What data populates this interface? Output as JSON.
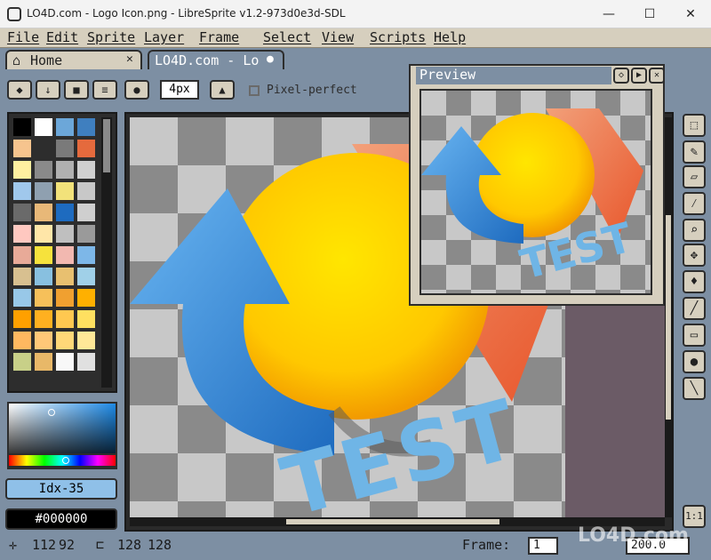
{
  "window": {
    "title": "LO4D.com - Logo Icon.png - LibreSprite v1.2-973d0e3d-SDL",
    "minimize_glyph": "—",
    "maximize_glyph": "☐",
    "close_glyph": "✕"
  },
  "menu": [
    "File",
    "Edit",
    "Sprite",
    "Layer",
    "Frame",
    "Select",
    "View",
    "Scripts",
    "Help"
  ],
  "tabs": [
    {
      "label": "Home",
      "close": "✕"
    },
    {
      "label": "LO4D.com - Lo",
      "dot": "●"
    }
  ],
  "toolbar": {
    "pixel_perfect": "Pixel-perfect",
    "brush_size": "4px"
  },
  "preview": {
    "title": "Preview"
  },
  "palette": {
    "colors": [
      "#000000",
      "#ffffff",
      "#6ca7d9",
      "#3f7fbf",
      "#f6c48e",
      "#2d2d2d",
      "#7a7a7a",
      "#e56a3d",
      "#fff0a0",
      "#8a8a8a",
      "#b0b0b0",
      "#d0d0d0",
      "#a0c8ec",
      "#8fa0b0",
      "#f2e27a",
      "#c8c8c8",
      "#6a6a6a",
      "#e8b878",
      "#1e6bbf",
      "#cfcfcf",
      "#ffc8c0",
      "#ffe6a8",
      "#bfbfbf",
      "#9a9a9a",
      "#e8aa98",
      "#f6e23c",
      "#f2b8b0",
      "#7db7e8",
      "#d8c090",
      "#88c0e0",
      "#e8c070",
      "#a0d0e8",
      "#98c8e8",
      "#f6c05a",
      "#f0a030",
      "#ffb000",
      "#ffa000",
      "#ffb020",
      "#ffc850",
      "#ffe060",
      "#ffb860",
      "#ffc878",
      "#ffd878",
      "#ffe898",
      "#c8d088",
      "#e8b868",
      "#f8f8f8",
      "#e0e0e0"
    ],
    "index_label": "Idx-35",
    "hex_label": "#000000"
  },
  "tools": [
    "marquee",
    "pencil",
    "eraser",
    "eyedropper",
    "zoom",
    "move",
    "fill",
    "line",
    "rectangle",
    "blob",
    "spray"
  ],
  "status": {
    "cursor_x": "112",
    "cursor_y": "92",
    "size_w": "128",
    "size_h": "128",
    "frame_label": "Frame:",
    "frame_value": "1",
    "zoom_value": "200.0",
    "zoom_button": "1:1"
  },
  "watermark": "LO4D.com",
  "canvas_text": "TEST"
}
